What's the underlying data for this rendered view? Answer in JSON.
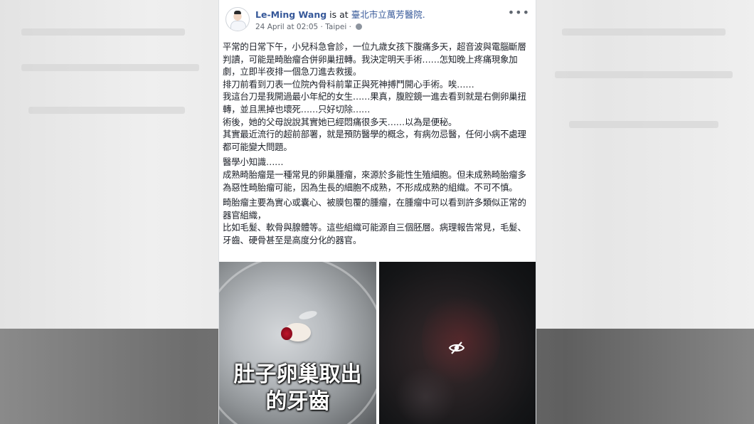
{
  "post": {
    "author": "Le-Ming Wang",
    "is_at": "is at",
    "place": "臺北市立萬芳醫院.",
    "timestamp": "24 April at 02:05",
    "location": "Taipei",
    "more_icon": "ellipsis-icon",
    "privacy_icon": "globe-icon",
    "paragraphs": [
      "平常的日常下午，小兒科急會診，一位九歲女孩下腹痛多天，超音波與電腦斷層判讀，可能是畸胎瘤合併卵巢扭轉。我決定明天手術……怎知晚上疼痛現象加劇，立即半夜排一個急刀進去救援。\n排刀前看到刀表一位院內骨科前輩正與死神搏鬥開心手術。唉……\n我這台刀是我開過最小年紀的女生……果真，腹腔鏡一進去看到就是右側卵巢扭轉，並且黑掉也壞死……只好切除……\n術後，她的父母說說其實她已經悶痛很多天……以為是便秘。\n其實最近流行的超前部署，就是預防醫學的概念，有病勿忌醫，任何小病不處理都可能變大問題。",
      "醫學小知識……\n成熟畸胎瘤是一種常見的卵巢腫瘤，來源於多能性生殖細胞。但未成熟畸胎瘤多為惡性畸胎瘤可能，因為生長的細胞不成熟，不形成成熟的組織。不可不慎。",
      "畸胎瘤主要為實心或囊心、被膜包覆的腫瘤，在腫瘤中可以看到許多類似正常的器官組織，\n比如毛髮、軟骨與腺體等。這些組織可能源自三個胚層。病理報告常見，毛髮、牙齒、硬骨甚至是高度分化的器官。"
    ]
  },
  "photos": {
    "left_caption_line1": "肚子卵巢取出",
    "left_caption_line2": "的牙齒",
    "right_icon": "eye-slash-icon"
  }
}
